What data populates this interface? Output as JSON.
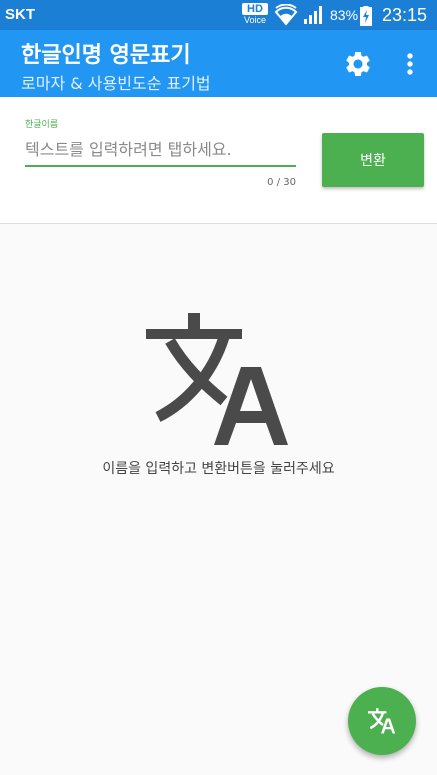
{
  "status_bar": {
    "carrier": "SKT",
    "hd_label": "HD",
    "voice_label": "Voice",
    "battery": "83%",
    "time": "23:15"
  },
  "app_bar": {
    "title": "한글인명 영문표기",
    "subtitle": "로마자 & 사용빈도순 표기법",
    "settings_icon": "gear-icon",
    "menu_icon": "more-vert-icon"
  },
  "form": {
    "label": "한글이름",
    "value": "",
    "placeholder": "텍스트를 입력하려면 탭하세요.",
    "counter": "0 / 30",
    "convert_label": "변환"
  },
  "empty_state": {
    "icon": "translate-icon",
    "message": "이름을 입력하고 변환버튼을 눌러주세요"
  },
  "fab": {
    "icon": "translate-icon"
  },
  "colors": {
    "status_bar": "#1c7fd6",
    "app_bar": "#2196f3",
    "accent": "#4caf50",
    "icon_gray": "#4a4a4a"
  }
}
